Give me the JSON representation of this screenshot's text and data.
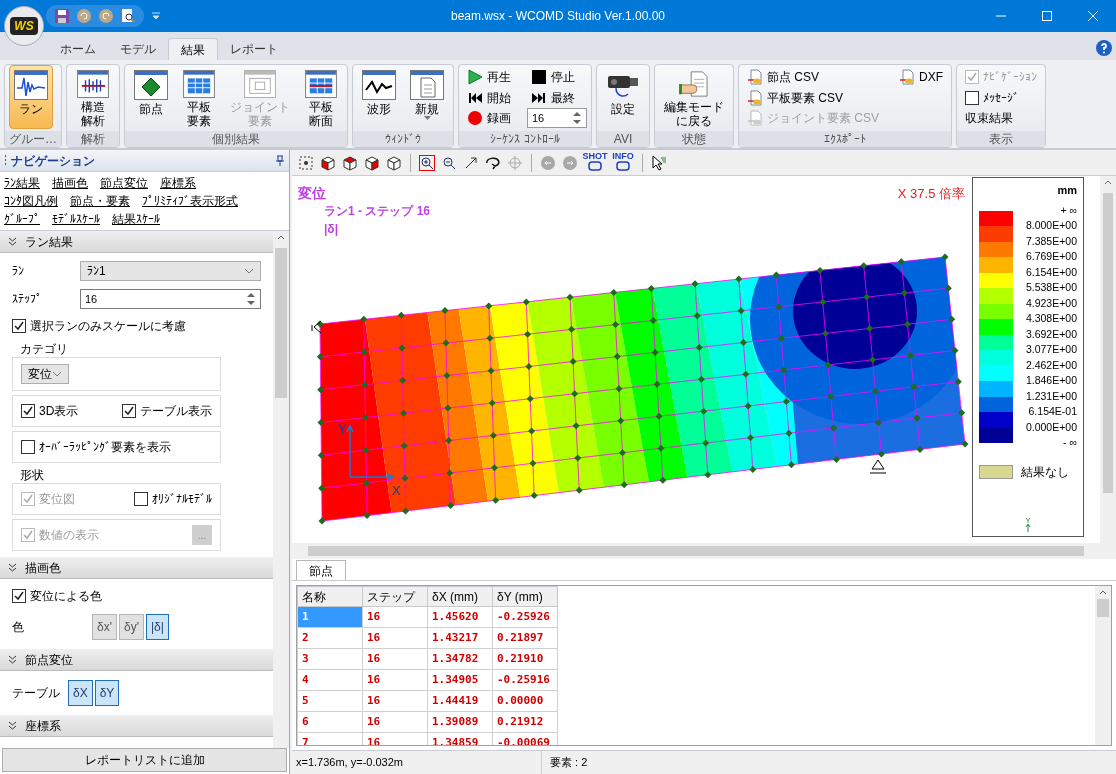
{
  "window": {
    "title": "beam.wsx - WCOMD Studio Ver.1.00.00",
    "logo": "WS"
  },
  "ribbon_tabs": [
    {
      "label": "ホーム",
      "selected": false
    },
    {
      "label": "モデル",
      "selected": false
    },
    {
      "label": "結果",
      "selected": true
    },
    {
      "label": "レポート",
      "selected": false
    }
  ],
  "ribbon_groups": [
    {
      "label": "グルー…",
      "items": [
        {
          "kind": "large",
          "lines": [
            "ラン"
          ],
          "selected": true,
          "disabled": false
        }
      ]
    },
    {
      "label": "解析",
      "items": [
        {
          "kind": "large",
          "lines": [
            "構造",
            "解析"
          ],
          "selected": false,
          "disabled": false
        }
      ]
    },
    {
      "label": "個別結果",
      "items": [
        {
          "kind": "large",
          "lines": [
            "節点"
          ],
          "selected": false,
          "disabled": false
        },
        {
          "kind": "large",
          "lines": [
            "平板",
            "要素"
          ],
          "selected": false,
          "disabled": false
        },
        {
          "kind": "large",
          "lines": [
            "ジョイント",
            "要素"
          ],
          "selected": false,
          "disabled": true
        },
        {
          "kind": "large",
          "lines": [
            "平板",
            "断面"
          ],
          "selected": false,
          "disabled": false
        }
      ]
    },
    {
      "label": "ｳｨﾝﾄﾞｳ",
      "items": [
        {
          "kind": "large",
          "lines": [
            "波形"
          ],
          "selected": false,
          "disabled": false
        },
        {
          "kind": "large",
          "lines": [
            "新規"
          ],
          "selected": false,
          "disabled": false,
          "dropdown": true
        }
      ]
    },
    {
      "label": "ｼｰｹﾝｽ ｺﾝﾄﾛｰﾙ",
      "items": [
        {
          "kind": "small",
          "label": "再生",
          "disabled": false
        },
        {
          "kind": "small",
          "label": "開始",
          "disabled": false
        },
        {
          "kind": "small",
          "label": "録画",
          "disabled": false
        },
        {
          "kind": "small",
          "label": "停止",
          "disabled": false
        },
        {
          "kind": "small",
          "label": "最終",
          "disabled": false
        },
        {
          "kind": "spin",
          "value": "16",
          "disabled": false
        }
      ]
    },
    {
      "label": "AVI",
      "items": [
        {
          "kind": "large",
          "lines": [
            "設定"
          ],
          "selected": false,
          "disabled": false
        }
      ]
    },
    {
      "label": "状態",
      "items": [
        {
          "kind": "large",
          "lines": [
            "編集モード",
            "に戻る"
          ],
          "selected": false,
          "disabled": false
        }
      ]
    },
    {
      "label": "ｴｸｽﾎﾟｰﾄ",
      "items": [
        {
          "kind": "small",
          "label": "節点 CSV",
          "disabled": false
        },
        {
          "kind": "small",
          "label": "平板要素 CSV",
          "disabled": false
        },
        {
          "kind": "small",
          "label": "ジョイント要素 CSV",
          "disabled": true
        },
        {
          "kind": "small",
          "label": "DXF",
          "disabled": false
        }
      ]
    },
    {
      "label": "表示",
      "items": [
        {
          "kind": "check",
          "label": "ﾅﾋﾞｹﾞｰｼｮﾝ",
          "checked": true,
          "disabled": true
        },
        {
          "kind": "check",
          "label": "ﾒｯｾｰｼﾞ",
          "checked": false,
          "disabled": false
        },
        {
          "kind": "text",
          "label": "収束結果",
          "disabled": false
        }
      ]
    }
  ],
  "navigation": {
    "title": "ナビゲーション",
    "links": [
      [
        "ﾗﾝ結果",
        "描画色",
        "節点変位",
        "座標系"
      ],
      [
        "ｺﾝﾀ図凡例",
        "節点・要素",
        "ﾌﾟﾘﾐﾃｨﾌﾞ表示形式"
      ],
      [
        "ｸﾞﾙｰﾌﾟ",
        "ﾓﾃﾞﾙｽｹｰﾙ",
        "結果ｽｹｰﾙ"
      ]
    ],
    "sections": [
      {
        "title": "ラン結果",
        "expanded": true,
        "rows": [
          {
            "kind": "select",
            "label": "ﾗﾝ",
            "value": "ﾗﾝ1"
          },
          {
            "kind": "spin",
            "label": "ｽﾃｯﾌﾟ",
            "value": "16"
          },
          {
            "kind": "check",
            "label": "選択ランのみスケールに考慮",
            "checked": true,
            "disabled": false
          },
          {
            "kind": "frame",
            "title": "カテゴリ",
            "items": [
              {
                "kind": "select",
                "value": "変位"
              }
            ]
          },
          {
            "kind": "frame",
            "items": [
              {
                "kind": "check",
                "label": "3D表示",
                "checked": true,
                "disabled": false
              },
              {
                "kind": "check",
                "label": "テーブル表示",
                "checked": true,
                "disabled": false
              }
            ]
          },
          {
            "kind": "frame",
            "items": [
              {
                "kind": "check",
                "label": "ｵｰﾊﾞｰﾗｯﾋﾟﾝｸﾞ要素を表示",
                "checked": false,
                "disabled": false
              }
            ]
          },
          {
            "kind": "frame",
            "title": "形状",
            "items": [
              {
                "kind": "check",
                "label": "変位図",
                "checked": true,
                "disabled": true
              },
              {
                "kind": "check",
                "label": "ｵﾘｼﾞﾅﾙﾓﾃﾞﾙ",
                "checked": false,
                "disabled": false
              }
            ]
          },
          {
            "kind": "frame",
            "items": [
              {
                "kind": "check",
                "label": "数値の表示",
                "checked": true,
                "disabled": true
              },
              {
                "kind": "button",
                "label": "...",
                "disabled": true
              }
            ]
          }
        ]
      },
      {
        "title": "描画色",
        "expanded": true,
        "rows": [
          {
            "kind": "check",
            "label": "変位による色",
            "checked": true,
            "disabled": false
          },
          {
            "kind": "toggles",
            "label": "色",
            "buttons": [
              {
                "label": "δx'",
                "selected": false
              },
              {
                "label": "δy'",
                "selected": false
              },
              {
                "label": "|δ|",
                "selected": true
              }
            ]
          }
        ]
      },
      {
        "title": "節点変位",
        "expanded": true,
        "rows": [
          {
            "kind": "toggles",
            "label": "テーブル",
            "buttons": [
              {
                "label": "δX",
                "selected": true
              },
              {
                "label": "δY",
                "selected": true
              }
            ]
          }
        ]
      },
      {
        "title": "座標系",
        "expanded": true
      }
    ],
    "report_button": "レポートリストに追加"
  },
  "viewport_toolbar": {
    "badges": [
      "SHOT",
      "INFO"
    ]
  },
  "viewport": {
    "title": "変位",
    "subtitle": "ラン1 - ステップ 16",
    "component": "|δ|",
    "scale": "X 37.5 倍率",
    "axis_labels": {
      "x": "X",
      "y": "Y"
    },
    "legend": {
      "unit": "mm",
      "labels": [
        "+ ∞",
        "8.000E+00",
        "7.385E+00",
        "6.769E+00",
        "6.154E+00",
        "5.538E+00",
        "4.923E+00",
        "4.308E+00",
        "3.692E+00",
        "3.077E+00",
        "2.462E+00",
        "1.846E+00",
        "1.231E+00",
        "6.154E-01",
        "0.000E+00",
        "- ∞"
      ],
      "bands": [
        {
          "color": "#ff0000"
        },
        {
          "color": "#ff3c00"
        },
        {
          "color": "#ff7800"
        },
        {
          "color": "#ffb400"
        },
        {
          "color": "#ffff00"
        },
        {
          "color": "#b4ff00"
        },
        {
          "color": "#78ff00"
        },
        {
          "color": "#00ff00"
        },
        {
          "color": "#00ff96"
        },
        {
          "color": "#00ffdc"
        },
        {
          "color": "#00ffff"
        },
        {
          "color": "#00b4ff"
        },
        {
          "color": "#0064dc"
        },
        {
          "color": "#0000c8"
        },
        {
          "color": "#000096"
        }
      ],
      "no_result": {
        "label": "結果なし",
        "color": "#d8d890"
      },
      "axis_label": "Y"
    }
  },
  "result_table": {
    "tab": {
      "label": "節点",
      "selected": true
    },
    "columns": [
      "名称",
      "ステップ",
      "δX (mm)",
      "δY (mm)"
    ],
    "rows": [
      {
        "cells": [
          "1",
          "16",
          "1.45620",
          "-0.25926"
        ],
        "selected": true
      },
      {
        "cells": [
          "2",
          "16",
          "1.43217",
          "0.21897"
        ],
        "selected": false
      },
      {
        "cells": [
          "3",
          "16",
          "1.34782",
          "0.21910"
        ],
        "selected": false
      },
      {
        "cells": [
          "4",
          "16",
          "1.34905",
          "-0.25916"
        ],
        "selected": false
      },
      {
        "cells": [
          "5",
          "16",
          "1.44419",
          "0.00000"
        ],
        "selected": false
      },
      {
        "cells": [
          "6",
          "16",
          "1.39089",
          "0.21912"
        ],
        "selected": false
      },
      {
        "cells": [
          "7",
          "16",
          "1.34859",
          "-0.00069"
        ],
        "selected": false
      }
    ]
  },
  "status_bar": [
    "x=1.736m, y=-0.032m",
    "要素 : 2"
  ]
}
